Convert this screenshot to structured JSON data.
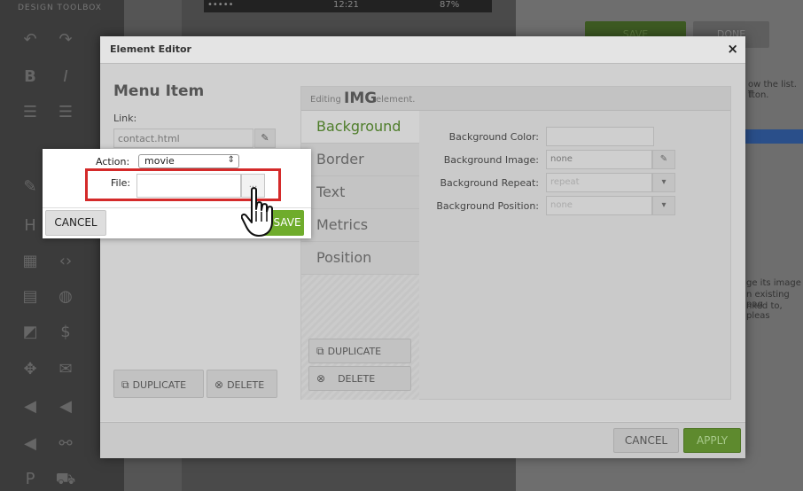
{
  "background": {
    "toolbar_title": "DESIGN TOOLBOX",
    "phone_status": {
      "carrier": "•••••",
      "time": "12:21",
      "battery": "87%"
    },
    "right_panel": {
      "save_label": "SAVE",
      "done_label": "DONE",
      "text_lines": [
        "ow the list. T",
        "tton.",
        "ge its image",
        "n existing pag",
        "nked to, pleas"
      ]
    }
  },
  "dialog": {
    "title": "Element Editor",
    "close_glyph": "×",
    "menu_item_title": "Menu Item",
    "link_label": "Link:",
    "link_value": "contact.html",
    "duplicate_label": "DUPLICATE",
    "delete_label": "DELETE",
    "editor": {
      "editing_prefix": "Editing",
      "element_tag": "IMG",
      "editing_suffix": "element.",
      "tabs": [
        {
          "label": "Background",
          "active": true
        },
        {
          "label": "Border",
          "active": false
        },
        {
          "label": "Text",
          "active": false
        },
        {
          "label": "Metrics",
          "active": false
        },
        {
          "label": "Position",
          "active": false
        }
      ],
      "properties": {
        "bg_color_label": "Background Color:",
        "bg_color_value": "",
        "bg_image_label": "Background Image:",
        "bg_image_value": "none",
        "bg_repeat_label": "Background Repeat:",
        "bg_repeat_value": "repeat",
        "bg_position_label": "Background Position:",
        "bg_position_value": "none"
      },
      "duplicate_label": "DUPLICATE",
      "delete_label": "DELETE"
    },
    "footer": {
      "cancel_label": "CANCEL",
      "apply_label": "APPLY"
    }
  },
  "popup": {
    "action_label": "Action:",
    "action_value": "movie",
    "file_label": "File:",
    "file_value": "",
    "browse_glyph": "...",
    "cancel_label": "CANCEL",
    "save_label": "SAVE"
  },
  "colors": {
    "accent_green": "#6fac2c",
    "highlight_red": "#d42a2a",
    "active_tab_text": "#4e7d2a"
  }
}
